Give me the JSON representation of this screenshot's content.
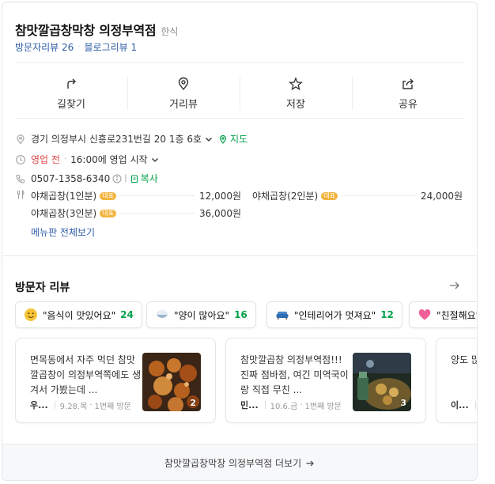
{
  "place": {
    "name": "참맛깔곱창막창 의정부역점",
    "category": "한식",
    "visitor_reviews": "방문자리뷰 26",
    "blog_reviews": "블로그리뷰 1"
  },
  "actions": {
    "directions": "길찾기",
    "street_view": "거리뷰",
    "save": "저장",
    "share": "공유"
  },
  "info": {
    "address": "경기 의정부시 신흥로231번길 20 1층 6호",
    "map_link": "지도",
    "status": "영업 전",
    "hours": "16:00에 영업 시작",
    "phone": "0507-1358-6340",
    "copy": "복사"
  },
  "menu": {
    "badge": "대표",
    "items": [
      {
        "name": "야채곱창(1인분)",
        "price": "12,000원"
      },
      {
        "name": "야채곱창(2인분)",
        "price": "24,000원"
      },
      {
        "name": "야채곱창(3인분)",
        "price": "36,000원"
      }
    ],
    "more": "메뉴판 전체보기"
  },
  "visitor_section": {
    "title": "방문자 리뷰",
    "chips": [
      {
        "label": "\"음식이 맛있어요\"",
        "count": "24"
      },
      {
        "label": "\"양이 많아요\"",
        "count": "16"
      },
      {
        "label": "\"인테리어가 멋져요\"",
        "count": "12"
      },
      {
        "label": "\"친절해요\"",
        "count": ""
      }
    ],
    "reviews": [
      {
        "text": "면목동에서 자주 먹던 참맛깔곱창이 의정부역쪽에도 생겨서 가봤는데 ...",
        "nick": "우...",
        "date": "9.28.목",
        "visit": "1번째 방문",
        "photos": "2"
      },
      {
        "text": "참맛깔곱창 의정부역점!!! 진짜 점바점, 여긴 미역국이랑 직접 무친 ...",
        "nick": "민...",
        "date": "10.6.금",
        "visit": "1번째 방문",
        "photos": "3"
      },
      {
        "text": "양도 많고!!!파... 었어용",
        "nick": "이...",
        "date": "",
        "visit": "",
        "photos": ""
      }
    ]
  },
  "footer": {
    "more": "참맛깔곱창막창 의정부역점 더보기"
  },
  "colors": {
    "link_blue": "#2f5da8",
    "green": "#03a14a",
    "status_red": "#e44545",
    "badge_orange": "#f3b33d"
  }
}
